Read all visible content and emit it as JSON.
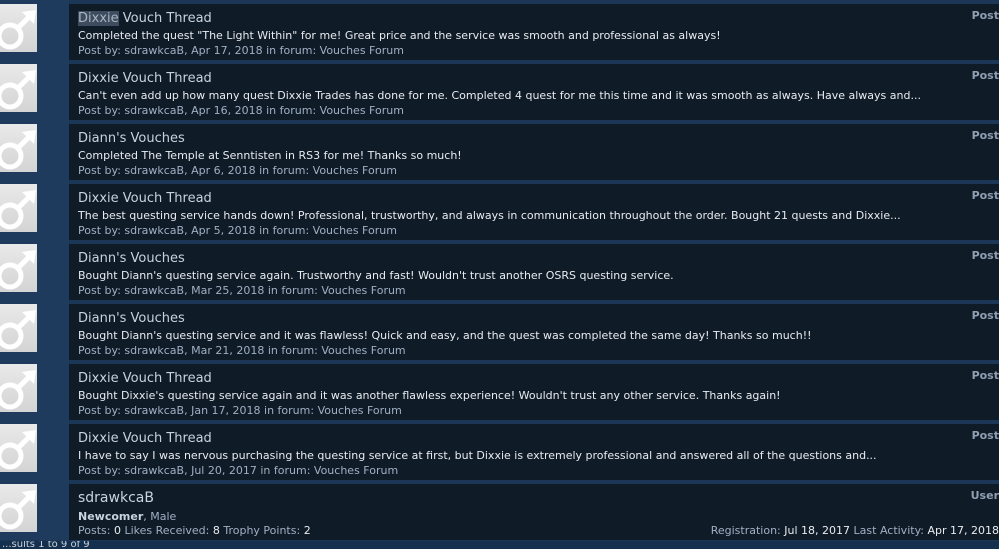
{
  "results": [
    {
      "title_highlight": "Dixxie",
      "title_rest": " Vouch Thread",
      "snippet": "Completed the quest \"The Light Within\" for me! Great price and the service was smooth and professional as always!",
      "author": "sdrawkcaB",
      "date": "Apr 17, 2018",
      "forum": "Vouches Forum",
      "type": "Post"
    },
    {
      "title_highlight": "",
      "title_rest": "Dixxie Vouch Thread",
      "snippet": "Can't even add up how many quest Dixxie Trades has done for me. Completed 4 quest for me this time and it was smooth as always. Have always and...",
      "author": "sdrawkcaB",
      "date": "Apr 16, 2018",
      "forum": "Vouches Forum",
      "type": "Post"
    },
    {
      "title_highlight": "",
      "title_rest": "Diann's Vouches",
      "snippet": "Completed The Temple at Senntisten in RS3 for me! Thanks so much!",
      "author": "sdrawkcaB",
      "date": "Apr 6, 2018",
      "forum": "Vouches Forum",
      "type": "Post"
    },
    {
      "title_highlight": "",
      "title_rest": "Dixxie Vouch Thread",
      "snippet": "The best questing service hands down! Professional, trustworthy, and always in communication throughout the order. Bought 21 quests and Dixxie...",
      "author": "sdrawkcaB",
      "date": "Apr 5, 2018",
      "forum": "Vouches Forum",
      "type": "Post"
    },
    {
      "title_highlight": "",
      "title_rest": "Diann's Vouches",
      "snippet": "Bought Diann's questing service again. Trustworthy and fast! Wouldn't trust another OSRS questing service.",
      "author": "sdrawkcaB",
      "date": "Mar 25, 2018",
      "forum": "Vouches Forum",
      "type": "Post"
    },
    {
      "title_highlight": "",
      "title_rest": "Diann's Vouches",
      "snippet": "Bought Diann's questing service and it was flawless! Quick and easy, and the quest was completed the same day! Thanks so much!!",
      "author": "sdrawkcaB",
      "date": "Mar 21, 2018",
      "forum": "Vouches Forum",
      "type": "Post"
    },
    {
      "title_highlight": "",
      "title_rest": "Dixxie Vouch Thread",
      "snippet": "Bought Dixxie's questing service again and it was another flawless experience! Wouldn't trust any other service. Thanks again!",
      "author": "sdrawkcaB",
      "date": "Jan 17, 2018",
      "forum": "Vouches Forum",
      "type": "Post"
    },
    {
      "title_highlight": "",
      "title_rest": "Dixxie Vouch Thread",
      "snippet": "I have to say I was nervous purchasing the questing service at first, but Dixxie is extremely professional and answered all of the questions and...",
      "author": "sdrawkcaB",
      "date": "Jul 20, 2017",
      "forum": "Vouches Forum",
      "type": "Post"
    }
  ],
  "labels": {
    "post_by": "Post by: ",
    "in_forum": " in forum: ",
    "comma": ", "
  },
  "user": {
    "name": "sdrawkcaB",
    "rank": "Newcomer",
    "gender": ", Male",
    "posts_label": "Posts: ",
    "posts": "0",
    "likes_label": " Likes Received: ",
    "likes": "8",
    "trophy_label": " Trophy Points: ",
    "trophy": "2",
    "reg_label": "Registration: ",
    "registration": "Jul 18, 2017",
    "activity_label": " Last Activity: ",
    "last_activity": "Apr 17, 2018",
    "type": "User"
  },
  "footer": {
    "text": "...sults 1 to 9 of 9"
  },
  "icons": {
    "avatar": "male-symbol-icon"
  },
  "colors": {
    "page_bg": "#1b3656",
    "row_bg": "#101b28",
    "highlight": "#3d4c5e"
  }
}
